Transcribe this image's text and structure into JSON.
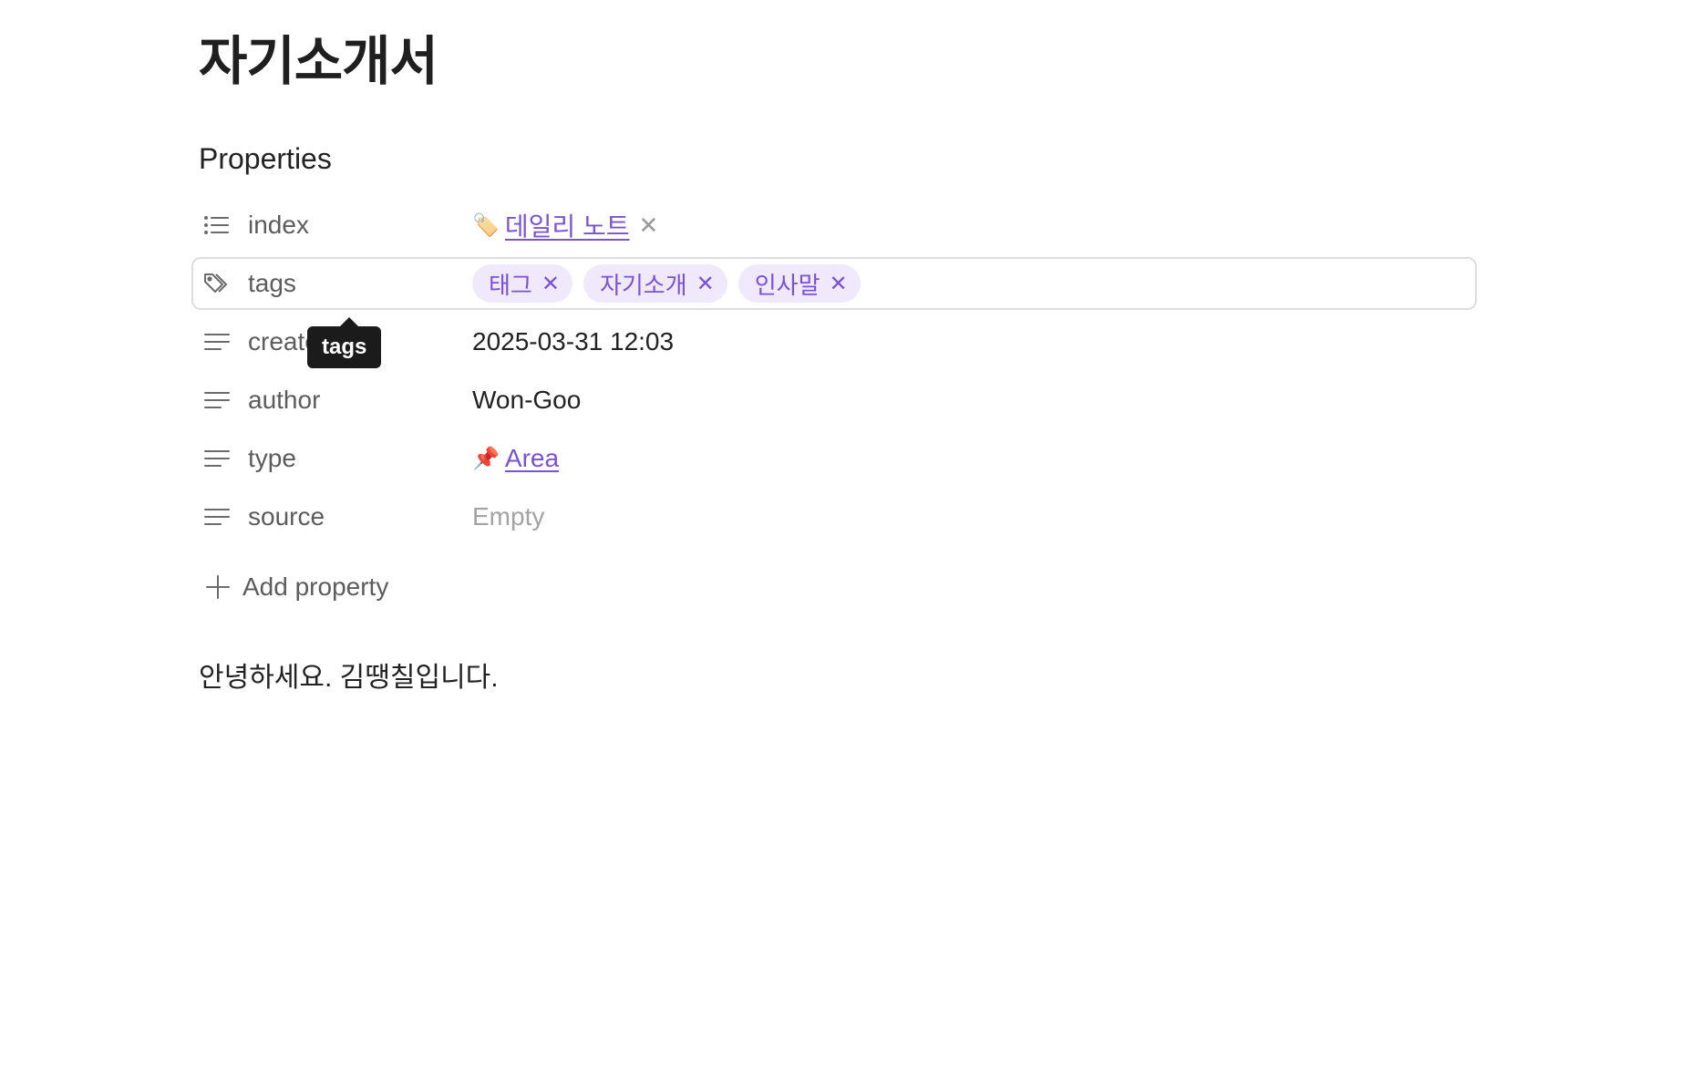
{
  "note": {
    "title": "자기소개서",
    "body": "안녕하세요. 김땡칠입니다."
  },
  "properties": {
    "heading": "Properties",
    "rows": [
      {
        "key": "index",
        "icon": "list-icon",
        "value": "데일리 노트",
        "value_emoji": "🏷️",
        "value_kind": "link"
      },
      {
        "key": "tags",
        "icon": "tags-icon",
        "tags": [
          "태그",
          "자기소개",
          "인사말"
        ],
        "value_kind": "tags"
      },
      {
        "key": "created",
        "icon": "text-icon",
        "value": "2025-03-31 12:03",
        "value_kind": "text"
      },
      {
        "key": "author",
        "icon": "text-icon",
        "value": "Won-Goo",
        "value_kind": "text"
      },
      {
        "key": "type",
        "icon": "text-icon",
        "value": "Area",
        "value_emoji": "📌",
        "value_kind": "link"
      },
      {
        "key": "source",
        "icon": "text-icon",
        "value": "Empty",
        "value_kind": "empty"
      }
    ],
    "add_label": "Add property"
  },
  "tooltip": {
    "text": "tags"
  },
  "glyphs": {
    "remove": "✕"
  },
  "colors": {
    "accent": "#7b52d6",
    "pill_bg": "#efe9fb",
    "tooltip_bg": "#1b1b1b"
  }
}
